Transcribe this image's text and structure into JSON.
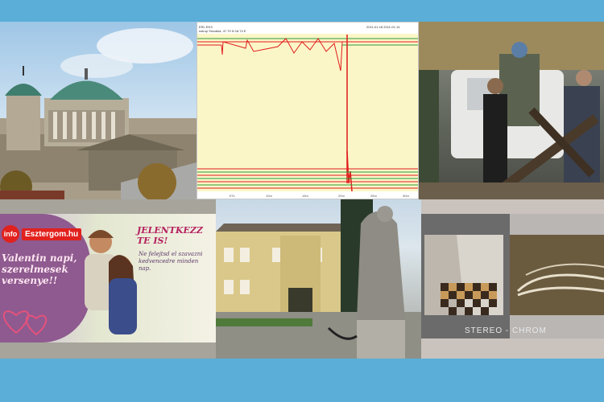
{
  "collage": {
    "seismogram": {
      "header_left": "ERL.EH3",
      "header_left2": "ustrup Slovakia, 47.79 N 18.74 E",
      "header_right": "2011-01-18 2011-01-14",
      "ticks": [
        "ETc",
        "10m",
        "15m",
        "20m",
        "25m",
        "30m"
      ]
    },
    "ad": {
      "logo_prefix": "info",
      "logo_name": "Esztergom.hu",
      "slogan": "Valentin napi, szerelmesek versenye!!",
      "title": "JELENTKEZZ TE IS!",
      "subtitle": "Ne felejtsd el szavazni kedvencedre minden nap."
    },
    "stereo": {
      "label": "STEREO - CHROM"
    }
  },
  "colors": {
    "frame": "#5aaed8",
    "seismic_red": "#e01b1b",
    "seismic_green": "#2e9a3a",
    "paper": "#fbf6c8"
  }
}
